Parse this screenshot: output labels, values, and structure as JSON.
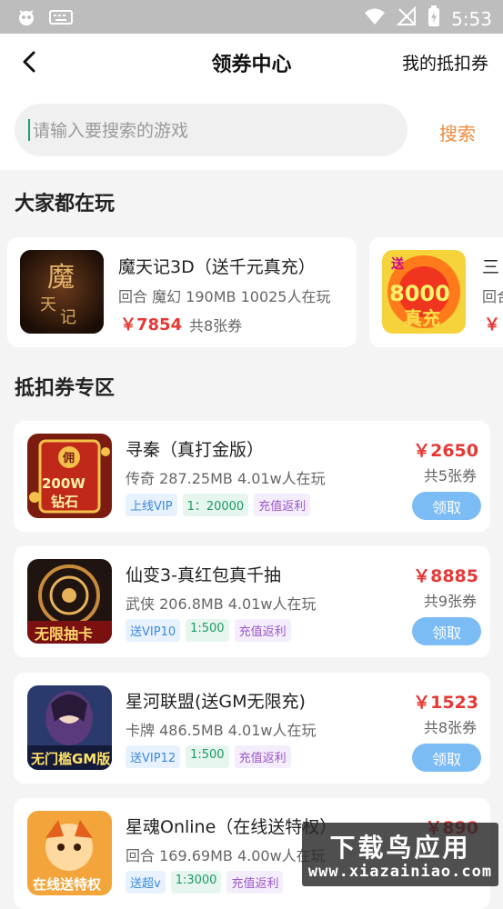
{
  "status_bar": {
    "time": "5:53"
  },
  "header": {
    "title": "领券中心",
    "my_coupons": "我的抵扣券"
  },
  "search": {
    "placeholder": "请输入要搜索的游戏",
    "button": "搜索"
  },
  "popular": {
    "title": "大家都在玩",
    "items": [
      {
        "name": "魔天记3D（送千元真充）",
        "meta": "回合 魔幻 190MB 10025人在玩",
        "price": "￥7854",
        "count": "共8张券"
      },
      {
        "name": "三",
        "meta": "回合",
        "price": "￥"
      }
    ]
  },
  "coupons": {
    "title": "抵扣券专区",
    "items": [
      {
        "name": "寻秦（真打金版）",
        "meta": "传奇 287.25MB 4.01w人在玩",
        "tags": [
          "上线VIP",
          "1：20000",
          "充值返利"
        ],
        "price": "￥2650",
        "count": "共5张券",
        "button": "领取"
      },
      {
        "name": "仙变3-真红包真千抽",
        "meta": "武侠 206.8MB 4.01w人在玩",
        "tags": [
          "送VIP10",
          "1:500",
          "充值返利"
        ],
        "price": "￥8885",
        "count": "共9张券",
        "button": "领取"
      },
      {
        "name": "星河联盟(送GM无限充)",
        "meta": "卡牌 486.5MB 4.01w人在玩",
        "tags": [
          "送VIP12",
          "1:500",
          "充值返利"
        ],
        "price": "￥1523",
        "count": "共8张券",
        "button": "领取"
      },
      {
        "name": "星魂Online（在线送特权）",
        "meta": "回合 169.69MB 4.00w人在玩",
        "tags": [
          "送超v",
          "1:3000",
          "充值返利"
        ],
        "price": "￥890"
      }
    ]
  },
  "watermark": {
    "line1": "下载鸟应用",
    "line2": "www.xiazainiao.com"
  },
  "colors": {
    "price_red": "#e53935",
    "accent_orange": "#f08a3c",
    "claim_blue": "#7bbcf5"
  }
}
